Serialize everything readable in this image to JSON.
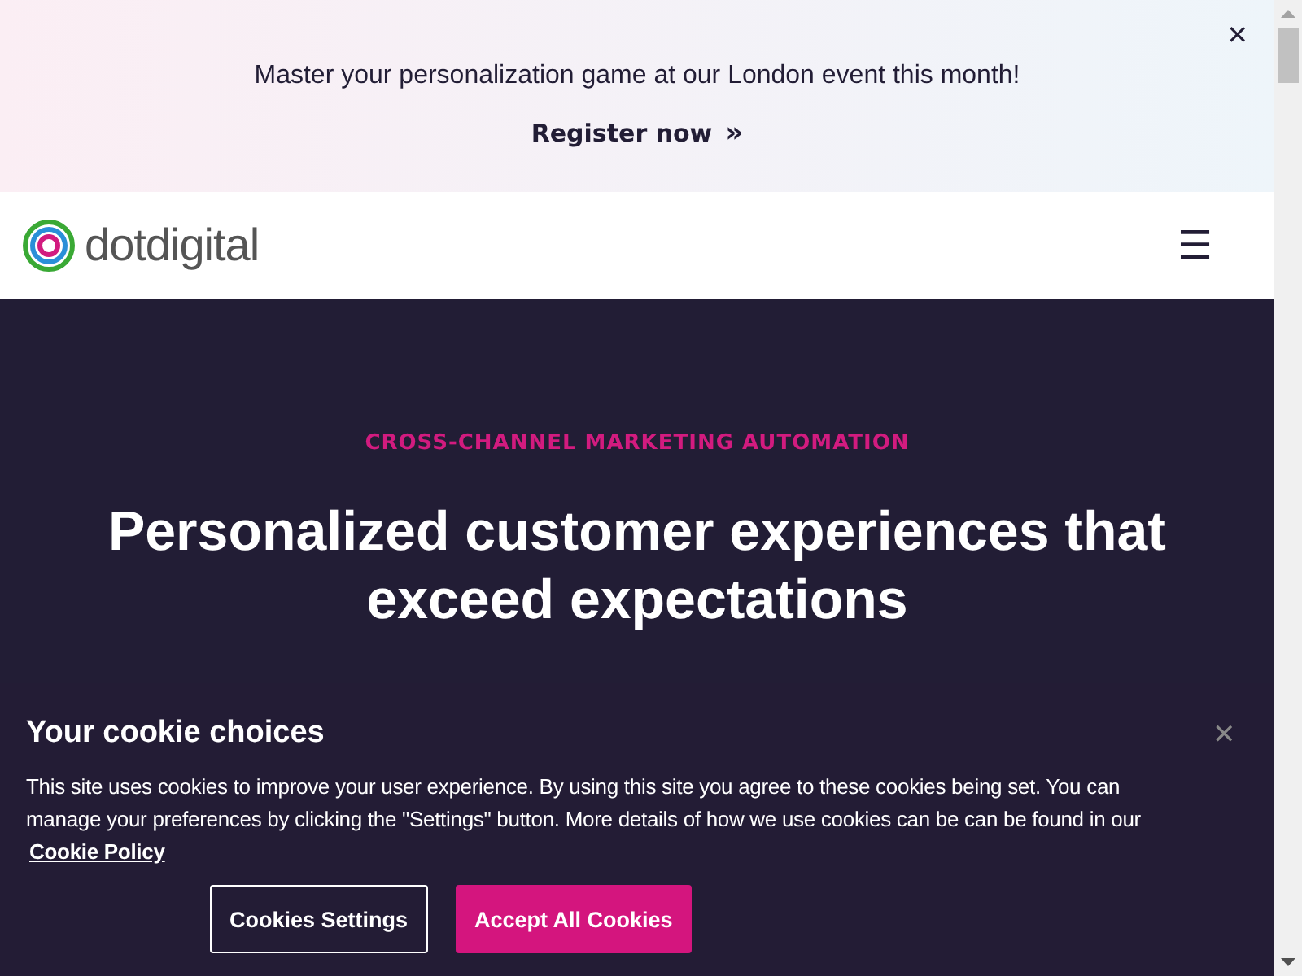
{
  "banner": {
    "message": "Master your personalization game at our London event this month!",
    "link": "Register now",
    "link_arrow": "»",
    "close": "✕"
  },
  "header": {
    "logo_text": "dotdigital",
    "menu": "☰"
  },
  "hero": {
    "eyebrow": "CROSS-CHANNEL MARKETING AUTOMATION",
    "title": "Personalized customer experiences that exceed expectations"
  },
  "cookie_panel": {
    "title": "Your cookie choices",
    "close": "✕",
    "body": "This site uses cookies to improve your user experience. By using this site you agree to these cookies being set. You can manage your preferences by clicking the \"Settings\" button. More details of how we use cookies can be can be found in our",
    "policy_link": "Cookie Policy",
    "buttons": [
      {
        "label": "Cookies Settings",
        "kind": "outline"
      },
      {
        "label": "Accept All Cookies",
        "kind": "primary"
      }
    ]
  }
}
